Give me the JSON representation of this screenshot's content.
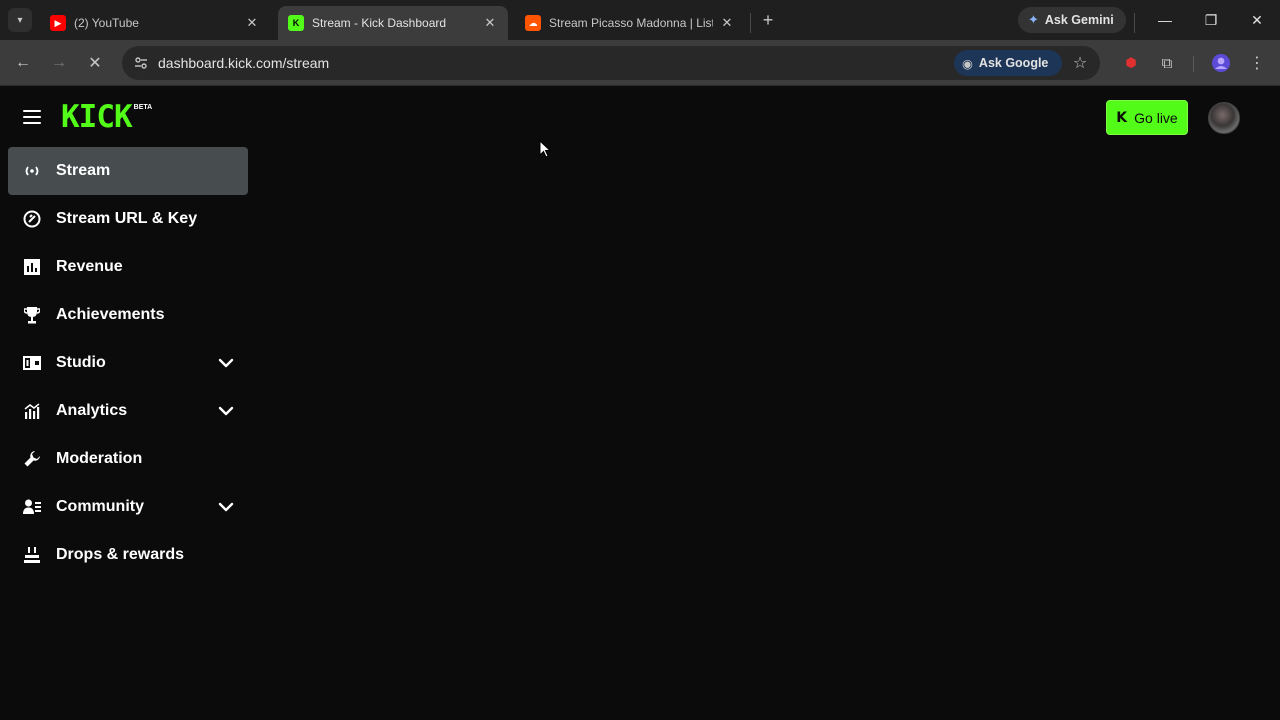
{
  "browser": {
    "tabs": [
      {
        "title": "(2) YouTube",
        "favicon": "youtube-icon",
        "active": false
      },
      {
        "title": "Stream - Kick Dashboard",
        "favicon": "kick-icon",
        "active": true
      },
      {
        "title": "Stream Picasso Madonna | Liste",
        "favicon": "soundcloud-icon",
        "active": false
      }
    ],
    "new_tab_label": "+",
    "gemini_label": "Ask Gemini",
    "url": "dashboard.kick.com/stream",
    "ask_google_label": "Ask Google"
  },
  "header": {
    "logo_text": "KICK",
    "logo_badge": "BETA",
    "go_live_label": "Go live"
  },
  "sidebar": {
    "items": [
      {
        "label": "Stream",
        "icon": "broadcast-icon",
        "active": true,
        "expandable": false
      },
      {
        "label": "Stream URL & Key",
        "icon": "link-icon",
        "active": false,
        "expandable": false
      },
      {
        "label": "Revenue",
        "icon": "bar-chart-icon",
        "active": false,
        "expandable": false
      },
      {
        "label": "Achievements",
        "icon": "trophy-icon",
        "active": false,
        "expandable": false
      },
      {
        "label": "Studio",
        "icon": "studio-icon",
        "active": false,
        "expandable": true
      },
      {
        "label": "Analytics",
        "icon": "analytics-icon",
        "active": false,
        "expandable": true
      },
      {
        "label": "Moderation",
        "icon": "wrench-icon",
        "active": false,
        "expandable": false
      },
      {
        "label": "Community",
        "icon": "community-icon",
        "active": false,
        "expandable": true
      },
      {
        "label": "Drops & rewards",
        "icon": "drops-icon",
        "active": false,
        "expandable": false
      }
    ]
  },
  "colors": {
    "brand_green": "#53fc18",
    "background": "#0b0b0b",
    "active_item": "#474d4f"
  }
}
